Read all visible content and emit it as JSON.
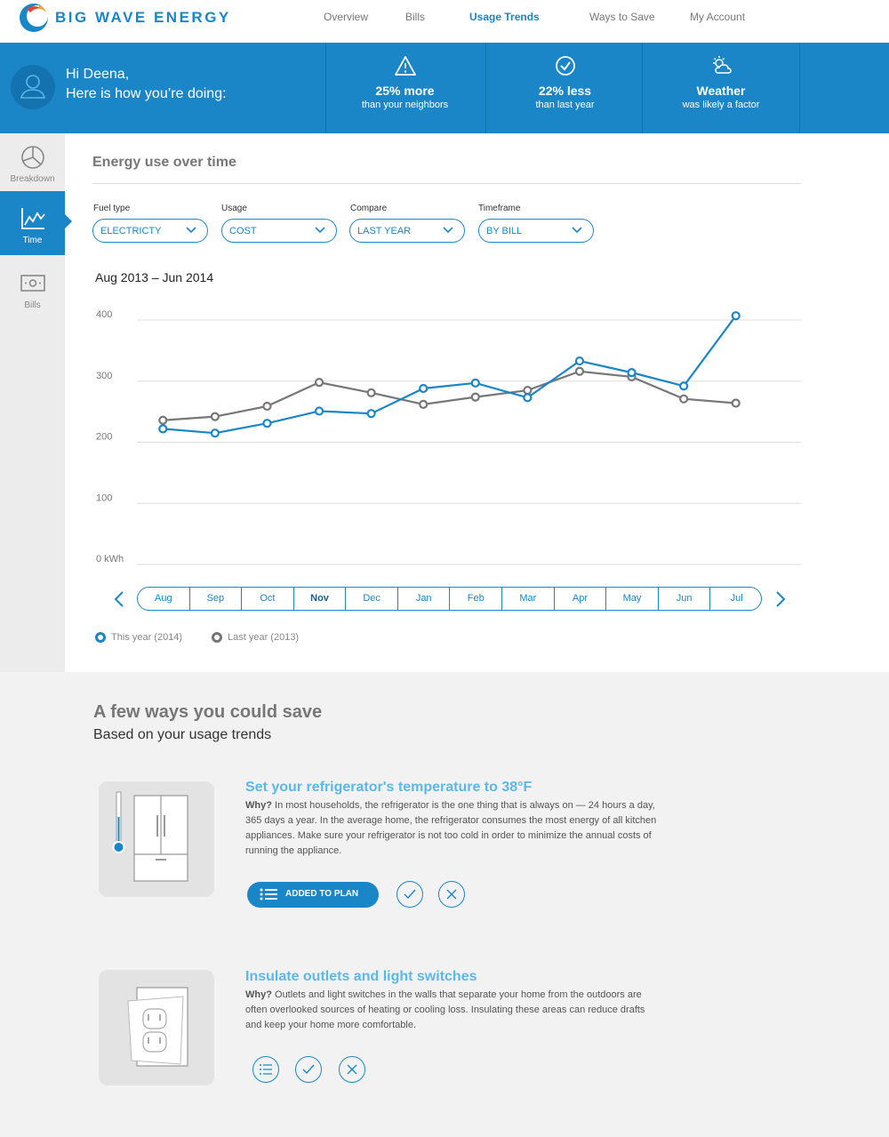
{
  "brand": {
    "name": "BIG WAVE ENERGY",
    "primary_color": "#1a86c8",
    "light_color": "#5bb8ea"
  },
  "nav": {
    "items": [
      {
        "label": "Overview",
        "active": false
      },
      {
        "label": "Bills",
        "active": false
      },
      {
        "label": "Usage Trends",
        "active": true
      },
      {
        "label": "Ways to Save",
        "active": false
      },
      {
        "label": "My Account",
        "active": false
      }
    ]
  },
  "banner": {
    "greeting_line1": "Hi Deena,",
    "greeting_line2": "Here is how you’re doing:",
    "stats": [
      {
        "icon": "warning-icon",
        "big": "25% more",
        "small": "than your neighbors"
      },
      {
        "icon": "check-circle-icon",
        "big": "22% less",
        "small": "than last year"
      },
      {
        "icon": "weather-icon",
        "big": "Weather",
        "small": "was likely a factor"
      }
    ]
  },
  "sidebar": {
    "items": [
      {
        "label": "Breakdown",
        "icon": "pie-chart-icon",
        "active": false
      },
      {
        "label": "Time",
        "icon": "line-chart-icon",
        "active": true
      },
      {
        "label": "Bills",
        "icon": "bill-icon",
        "active": false
      }
    ]
  },
  "panel": {
    "title": "Energy use over time",
    "filters": [
      {
        "label": "Fuel type",
        "value": "ELECTRICTY"
      },
      {
        "label": "Usage",
        "value": "COST"
      },
      {
        "label": "Compare",
        "value": "LAST YEAR"
      },
      {
        "label": "Timeframe",
        "value": "BY BILL"
      }
    ],
    "range_title": "Aug 2013 – Jun 2014"
  },
  "chart_data": {
    "type": "line",
    "title": "Aug 2013 – Jun 2014",
    "categories": [
      "Aug",
      "Sep",
      "Oct",
      "Nov",
      "Dec",
      "Jan",
      "Feb",
      "Mar",
      "Apr",
      "May",
      "Jun",
      "Jul"
    ],
    "series": [
      {
        "name": "This year (2014)",
        "color": "#1a86c8",
        "values": [
          222,
          215,
          231,
          251,
          247,
          288,
          297,
          273,
          333,
          314,
          292,
          407
        ]
      },
      {
        "name": "Last year (2013)",
        "color": "#777777",
        "values": [
          236,
          242,
          259,
          298,
          281,
          262,
          274,
          285,
          316,
          307,
          271,
          264
        ]
      }
    ],
    "ylim": [
      0,
      400
    ],
    "yticks": [
      0,
      100,
      200,
      300,
      400
    ],
    "ytick_labels": [
      "0  kWh",
      "100",
      "200",
      "300",
      "400"
    ],
    "bold_category": "Nov",
    "grid": true
  },
  "legend": [
    {
      "label": "This year (2014)",
      "color": "#1a86c8"
    },
    {
      "label": "Last year (2013)",
      "color": "#777777"
    }
  ],
  "savings": {
    "title": "A few ways you could save",
    "subtitle": "Based on your usage trends",
    "tips": [
      {
        "title": "Set your refrigerator's temperature to 38°F",
        "why": "Why?",
        "body": " In most households, the refrigerator is the one thing that is always on — 24 hours a day, 365 days a year. In the average home, the refrigerator consumes the most energy of all kitchen appliances. Make sure your refrigerator is not too cold in order to minimize the annual costs of running the appliance.",
        "button": "ADDED TO PLAN",
        "image": "refrigerator-icon"
      },
      {
        "title": "Insulate outlets and light switches",
        "why": "Why?",
        "body": " Outlets and light switches in the walls that separate your home from the outdoors are often overlooked sources of heating or cooling loss. Insulating these areas can reduce drafts and keep your home more comfortable.",
        "image": "outlet-icon"
      }
    ]
  }
}
